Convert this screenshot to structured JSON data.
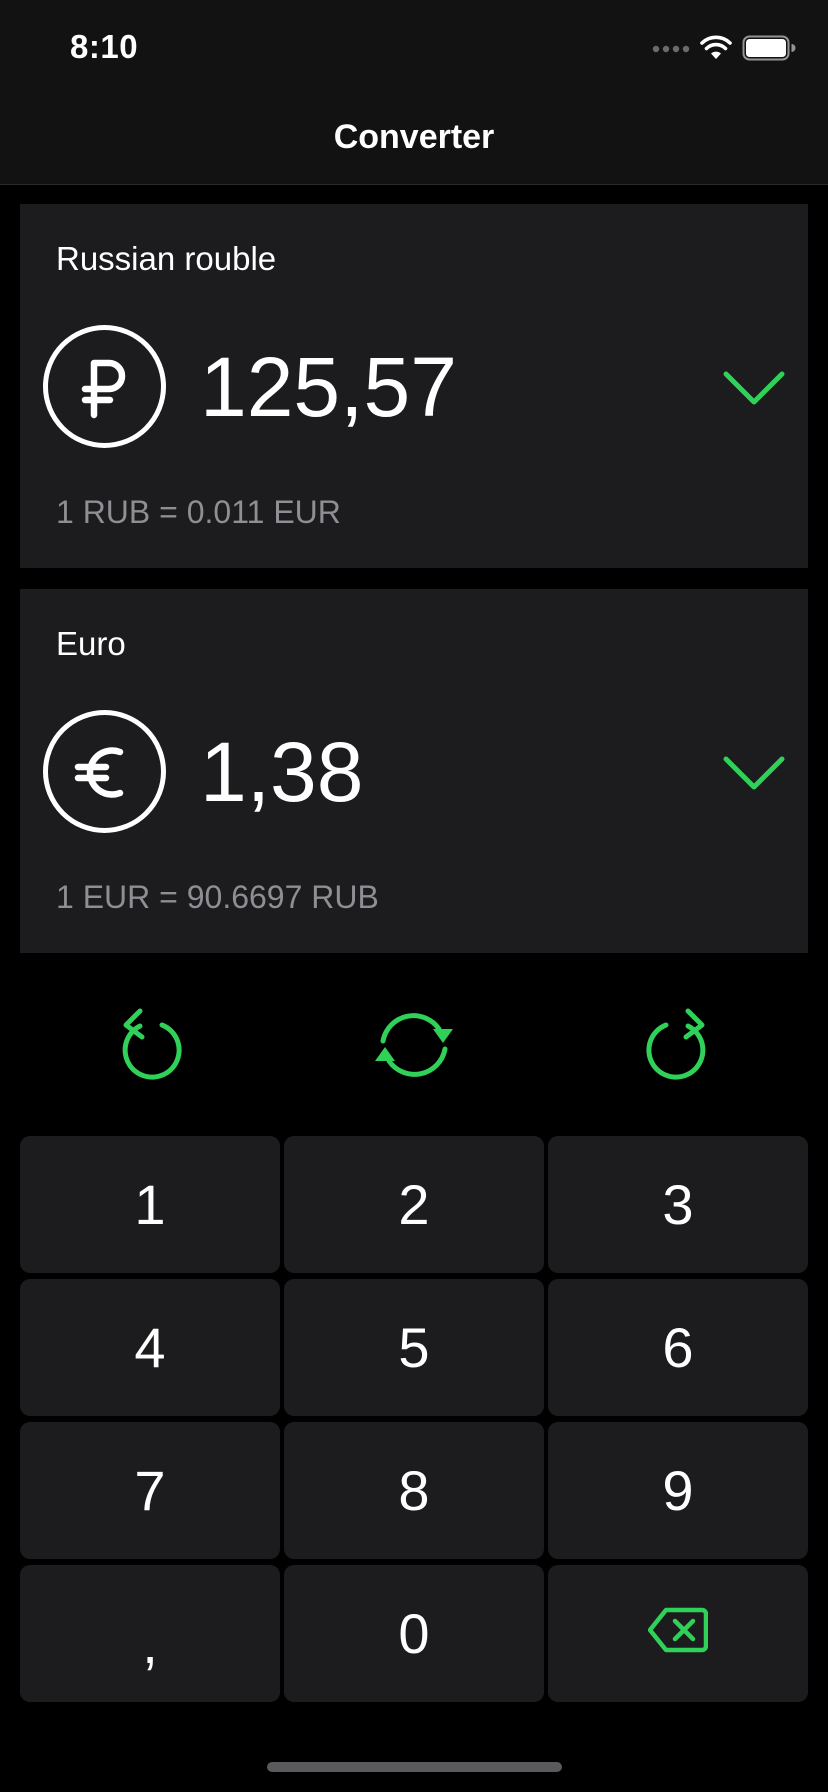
{
  "status_bar": {
    "time": "8:10",
    "icons": [
      "signal-icon",
      "wifi-icon",
      "battery-icon"
    ]
  },
  "nav": {
    "title": "Converter"
  },
  "colors": {
    "accent": "#30d158",
    "card_background": "#1c1c1e",
    "secondary_text": "#8e8e93"
  },
  "converter": {
    "from": {
      "name": "Russian rouble",
      "symbol_icon": "ruble-icon",
      "amount": "125,57",
      "rate": "1 RUB = 0.011 EUR"
    },
    "to": {
      "name": "Euro",
      "symbol_icon": "euro-icon",
      "amount": "1,38",
      "rate": "1 EUR = 90.6697 RUB"
    }
  },
  "actions": [
    "undo-icon",
    "swap-icon",
    "redo-icon"
  ],
  "keypad": {
    "keys": [
      "1",
      "2",
      "3",
      "4",
      "5",
      "6",
      "7",
      "8",
      "9",
      ",",
      "0"
    ],
    "backspace_icon": "backspace-icon"
  }
}
